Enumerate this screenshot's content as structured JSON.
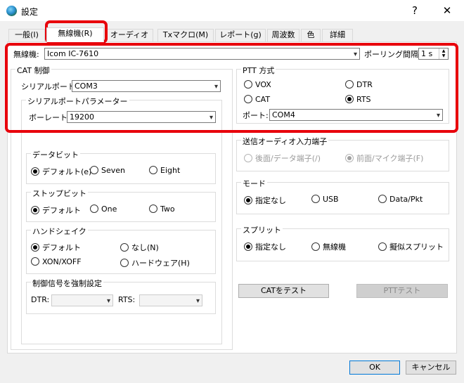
{
  "window": {
    "title": "設定",
    "help_label": "?",
    "close_label": "✕"
  },
  "tabs": [
    {
      "label": "一般(I)"
    },
    {
      "label": "無線機(R)"
    },
    {
      "label": "オーディオ(u)"
    },
    {
      "label": "Txマクロ(M)"
    },
    {
      "label": "レポート(g)"
    },
    {
      "label": "周波数"
    },
    {
      "label": "色"
    },
    {
      "label": "詳細"
    }
  ],
  "radio": {
    "label": "無線機:",
    "value": "Icom IC-7610",
    "polling_label": "ポーリング間隔:",
    "polling_value": "1 s"
  },
  "cat": {
    "title": "CAT 制御",
    "serial_port_label": "シリアルポート:",
    "serial_port_value": "COM3",
    "params_title": "シリアルポートパラメーター",
    "baud_label": "ボーレート:",
    "baud_value": "19200",
    "databits": {
      "title": "データビット",
      "options": [
        "デフォルト(e)",
        "Seven",
        "Eight"
      ],
      "selected": 0
    },
    "stopbits": {
      "title": "ストップビット",
      "options": [
        "デフォルト",
        "One",
        "Two"
      ],
      "selected": 0
    },
    "handshake": {
      "title": "ハンドシェイク",
      "options": [
        "デフォルト",
        "なし(N)",
        "XON/XOFF",
        "ハードウェア(H)"
      ],
      "selected": 0
    },
    "force": {
      "title": "制御信号を強制設定",
      "dtr_label": "DTR:",
      "rts_label": "RTS:"
    }
  },
  "ptt": {
    "title": "PTT 方式",
    "options": [
      "VOX",
      "DTR",
      "CAT",
      "RTS"
    ],
    "selected": 3,
    "port_label": "ポート:",
    "port_value": "COM4"
  },
  "tx_audio": {
    "title": "送信オーディオ入力端子",
    "options": [
      "後面/データ端子(/)",
      "前面/マイク端子(F)"
    ],
    "selected": 1
  },
  "mode": {
    "title": "モード",
    "options": [
      "指定なし",
      "USB",
      "Data/Pkt"
    ],
    "selected": 0
  },
  "split": {
    "title": "スプリット",
    "options": [
      "指定なし",
      "無線機",
      "擬似スプリット"
    ],
    "selected": 0
  },
  "buttons": {
    "test_cat": "CATをテスト",
    "test_ptt": "PTTテスト",
    "ok": "OK",
    "cancel": "キャンセル"
  },
  "colors": {
    "highlight": "#e8000b",
    "accent": "#0078d7"
  },
  "icons": {
    "chevron": "▾"
  }
}
